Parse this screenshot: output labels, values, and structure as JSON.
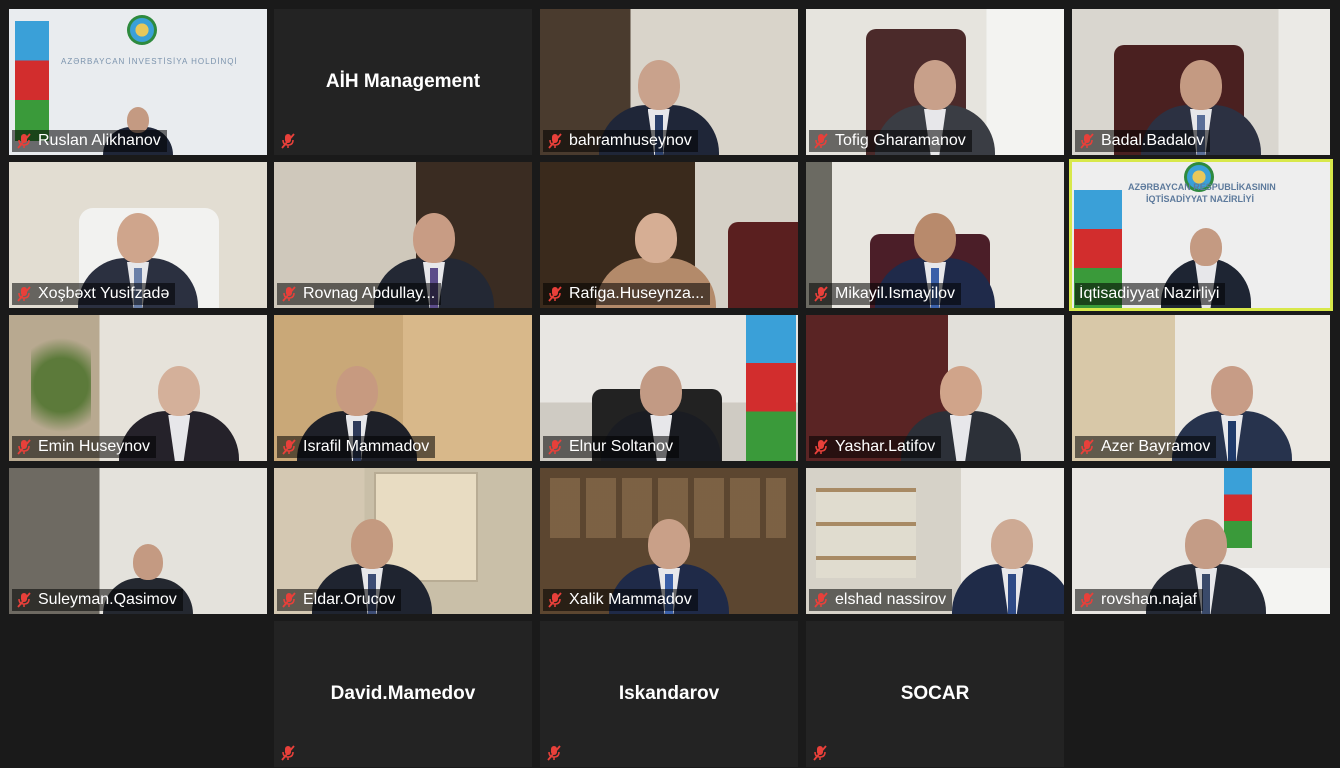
{
  "participants": [
    {
      "name": "Ruslan Alikhanov",
      "video": true,
      "muted": true,
      "logo_text": "AZƏRBAYCAN İNVESTİSİYA HOLDİNQİ"
    },
    {
      "name": "AİH Management",
      "video": false,
      "muted": true
    },
    {
      "name": "bahramhuseynov",
      "video": true,
      "muted": true
    },
    {
      "name": "Tofig Gharamanov",
      "video": true,
      "muted": true
    },
    {
      "name": "Badal.Badalov",
      "video": true,
      "muted": true
    },
    {
      "name": "Xoşbəxt Yusifzadə",
      "video": true,
      "muted": true
    },
    {
      "name": "Rovnag Abdullay...",
      "video": true,
      "muted": true
    },
    {
      "name": "Rafiga.Huseynza...",
      "video": true,
      "muted": true
    },
    {
      "name": "Mikayil.Ismayilov",
      "video": true,
      "muted": true
    },
    {
      "name": "İqtisadiyyat Nazirliyi",
      "video": true,
      "muted": false,
      "active_speaker": true,
      "logo_text_1": "AZƏRBAYCAN RESPUBLİKASININ",
      "logo_text_2": "İQTİSADİYYAT NAZİRLİYİ"
    },
    {
      "name": "Emin Huseynov",
      "video": true,
      "muted": true
    },
    {
      "name": "Israfil Mammadov",
      "video": true,
      "muted": true
    },
    {
      "name": "Elnur Soltanov",
      "video": true,
      "muted": true
    },
    {
      "name": "Yashar.Latifov",
      "video": true,
      "muted": true
    },
    {
      "name": "Azer Bayramov",
      "video": true,
      "muted": true
    },
    {
      "name": "Suleyman.Qasimov",
      "video": true,
      "muted": true
    },
    {
      "name": "Eldar.Orucov",
      "video": true,
      "muted": true
    },
    {
      "name": "Xalik Mammadov",
      "video": true,
      "muted": true
    },
    {
      "name": "elshad nassirov",
      "video": true,
      "muted": true
    },
    {
      "name": "rovshan.najaf",
      "video": true,
      "muted": true
    },
    {
      "name": "David.Mamedov",
      "video": false,
      "muted": true
    },
    {
      "name": "Iskandarov",
      "video": false,
      "muted": true
    },
    {
      "name": "SOCAR",
      "video": false,
      "muted": true
    }
  ],
  "colors": {
    "active_border": "#d8e84a",
    "mute_icon": "#e8403a",
    "tile_blank": "#232323"
  }
}
